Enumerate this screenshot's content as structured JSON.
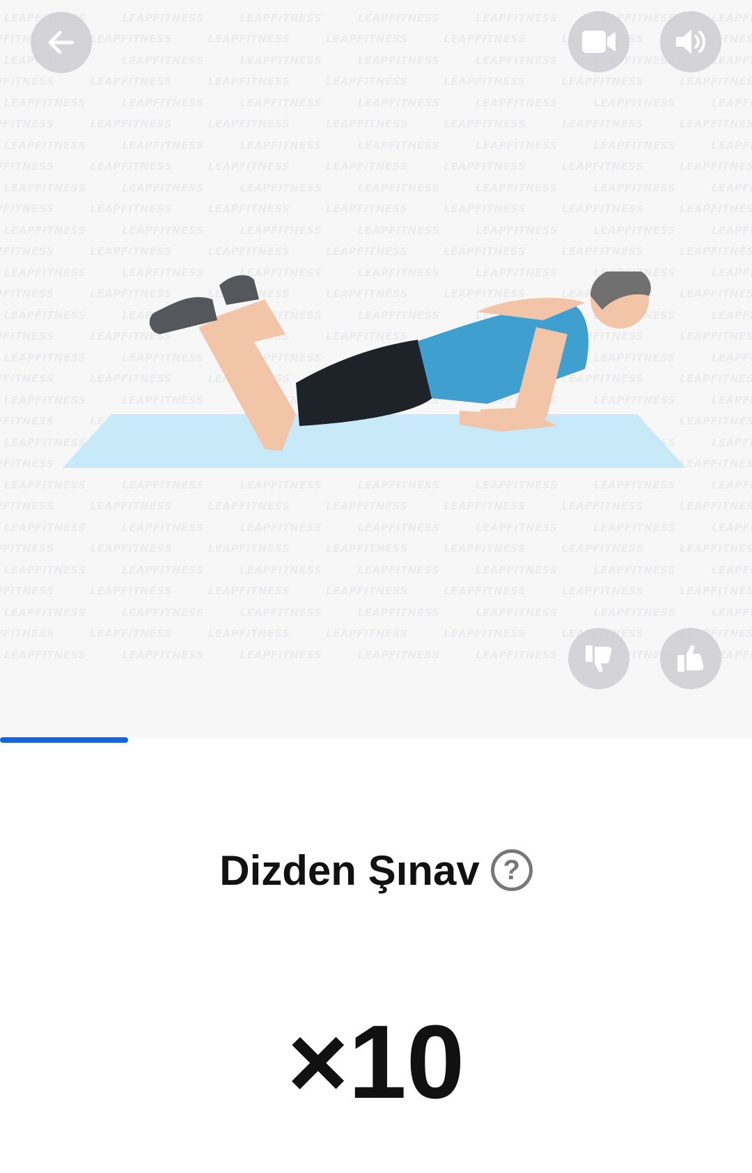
{
  "media": {
    "watermark_text": "LEAPFITNESS",
    "buttons": {
      "back_icon": "arrow-left-icon",
      "video_icon": "video-camera-icon",
      "sound_icon": "speaker-volume-icon",
      "dislike_icon": "thumbs-down-icon",
      "like_icon": "thumbs-up-icon"
    }
  },
  "progress": {
    "fraction": 0.17,
    "color": "#1565e0"
  },
  "exercise": {
    "name": "Dizden Şınav",
    "help_symbol": "?",
    "reps": "×10"
  }
}
